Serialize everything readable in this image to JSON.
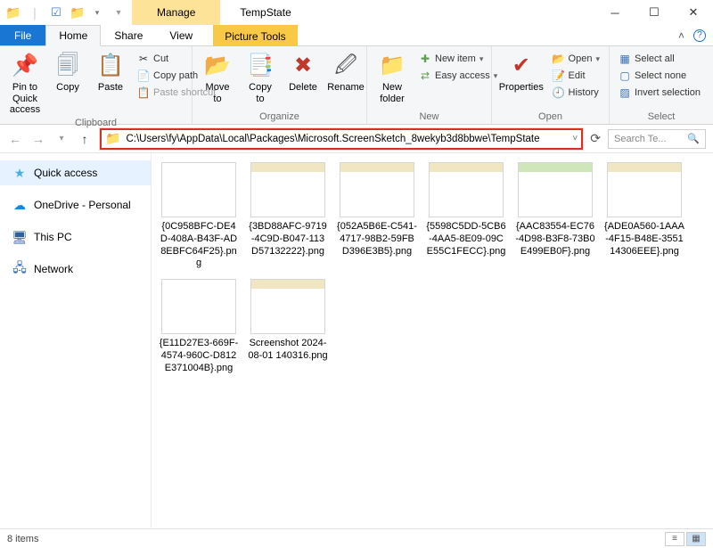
{
  "titlebar": {
    "manage_label": "Manage",
    "app_title": "TempState"
  },
  "tabs": {
    "file": "File",
    "home": "Home",
    "share": "Share",
    "view": "View",
    "picture_tools": "Picture Tools"
  },
  "ribbon": {
    "clipboard": {
      "label": "Clipboard",
      "pin": "Pin to Quick\naccess",
      "copy": "Copy",
      "paste": "Paste",
      "cut": "Cut",
      "copy_path": "Copy path",
      "paste_shortcut": "Paste shortcut"
    },
    "organize": {
      "label": "Organize",
      "move_to": "Move\nto",
      "copy_to": "Copy\nto",
      "delete": "Delete",
      "rename": "Rename"
    },
    "new": {
      "label": "New",
      "new_folder": "New\nfolder",
      "new_item": "New item",
      "easy_access": "Easy access"
    },
    "open_group": {
      "label": "Open",
      "properties": "Properties",
      "open": "Open",
      "edit": "Edit",
      "history": "History"
    },
    "select": {
      "label": "Select",
      "select_all": "Select all",
      "select_none": "Select none",
      "invert": "Invert selection"
    }
  },
  "address": {
    "path": "C:\\Users\\fy\\AppData\\Local\\Packages\\Microsoft.ScreenSketch_8wekyb3d8bbwe\\TempState"
  },
  "search": {
    "placeholder": "Search Te..."
  },
  "sidebar": {
    "items": [
      {
        "label": "Quick access"
      },
      {
        "label": "OneDrive - Personal"
      },
      {
        "label": "This PC"
      },
      {
        "label": "Network"
      }
    ]
  },
  "files": [
    "{0C958BFC-DE4D-408A-B43F-AD8EBFC64F25}.png",
    "{3BD88AFC-9719-4C9D-B047-113D57132222}.png",
    "{052A5B6E-C541-4717-98B2-59FBD396E3B5}.png",
    "{5598C5DD-5CB6-4AA5-8E09-09CE55C1FECC}.png",
    "{AAC83554-EC76-4D98-B3F8-73B0E499EB0F}.png",
    "{ADE0A560-1AAA-4F15-B48E-355114306EEE}.png",
    "{E11D27E3-669F-4574-960C-D812E371004B}.png",
    "Screenshot 2024-08-01 140316.png"
  ],
  "status": {
    "text": "8 items"
  }
}
